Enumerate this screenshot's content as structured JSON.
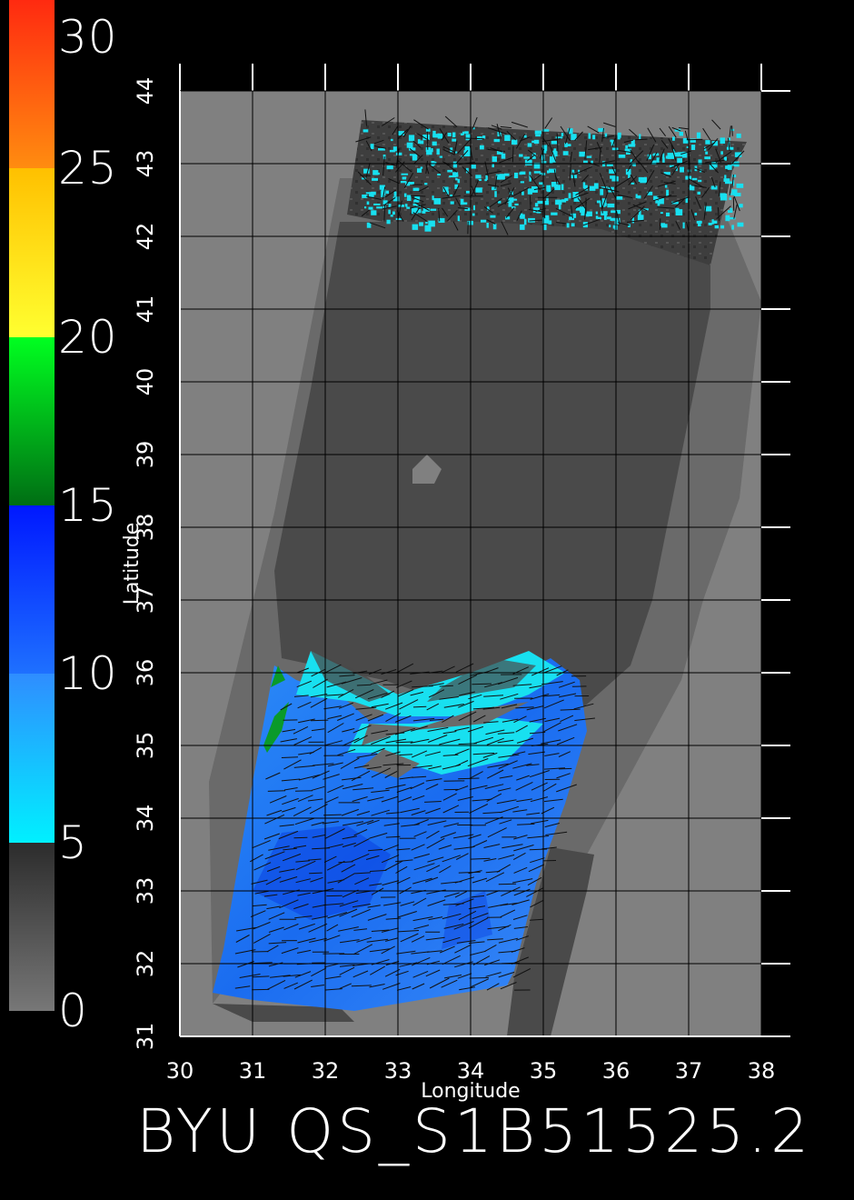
{
  "chart_data": {
    "type": "heatmap",
    "title": "BYU QS_S1B51525.2",
    "xlabel": "Longitude",
    "ylabel": "Latitude",
    "xlim": [
      30,
      38
    ],
    "ylim": [
      31,
      44
    ],
    "x_ticks": [
      "30",
      "31",
      "32",
      "33",
      "34",
      "35",
      "36",
      "37",
      "38"
    ],
    "y_ticks": [
      "31",
      "32",
      "33",
      "34",
      "35",
      "36",
      "37",
      "38",
      "39",
      "40",
      "41",
      "42",
      "43",
      "44"
    ],
    "grid": true,
    "colorbar": {
      "range": [
        0,
        30
      ],
      "ticks": [
        "30",
        "25",
        "20",
        "15",
        "10",
        "5",
        "0"
      ],
      "segments": [
        {
          "from": 0,
          "to": 5,
          "colors": [
            "#777777",
            "#2c2c2c"
          ]
        },
        {
          "from": 5,
          "to": 10,
          "colors": [
            "#00f0ff",
            "#2f8dff"
          ]
        },
        {
          "from": 10,
          "to": 15,
          "colors": [
            "#1e70ff",
            "#0018ff"
          ]
        },
        {
          "from": 15,
          "to": 20,
          "colors": [
            "#006e14",
            "#00ff20"
          ]
        },
        {
          "from": 20,
          "to": 25,
          "colors": [
            "#ffff30",
            "#ffc000"
          ]
        },
        {
          "from": 25,
          "to": 30,
          "colors": [
            "#ff8c10",
            "#ff2a10"
          ]
        }
      ]
    },
    "colors": {
      "background": "#000000",
      "land": "#808080",
      "swath_low": "#4a4a4a",
      "swath_mid": "#6a6a6a",
      "cyan": "#18e0f0",
      "blue": "#1a74f0",
      "deep_blue": "#0a40e0",
      "green": "#0a9a2a",
      "grid": "#000000"
    }
  }
}
